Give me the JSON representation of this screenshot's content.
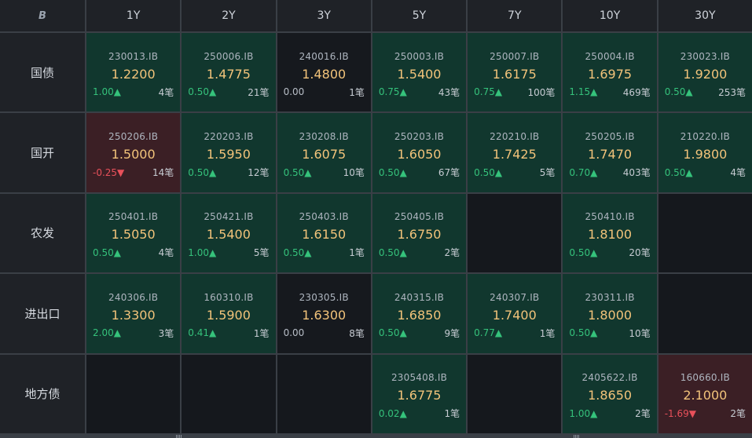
{
  "corner_label": "B",
  "columns": [
    "1Y",
    "2Y",
    "3Y",
    "5Y",
    "7Y",
    "10Y",
    "30Y"
  ],
  "rows": [
    {
      "label": "国债",
      "cells": [
        {
          "code": "230013.IB",
          "price": "1.2200",
          "change": "1.00▲",
          "count": "4笔",
          "dir": "up",
          "bg": "green"
        },
        {
          "code": "250006.IB",
          "price": "1.4775",
          "change": "0.50▲",
          "count": "21笔",
          "dir": "up",
          "bg": "green"
        },
        {
          "code": "240016.IB",
          "price": "1.4800",
          "change": "0.00",
          "count": "1笔",
          "dir": "flat",
          "bg": "dark"
        },
        {
          "code": "250003.IB",
          "price": "1.5400",
          "change": "0.75▲",
          "count": "43笔",
          "dir": "up",
          "bg": "green"
        },
        {
          "code": "250007.IB",
          "price": "1.6175",
          "change": "0.75▲",
          "count": "100笔",
          "dir": "up",
          "bg": "green"
        },
        {
          "code": "250004.IB",
          "price": "1.6975",
          "change": "1.15▲",
          "count": "469笔",
          "dir": "up",
          "bg": "green"
        },
        {
          "code": "230023.IB",
          "price": "1.9200",
          "change": "0.50▲",
          "count": "253笔",
          "dir": "up",
          "bg": "green"
        }
      ]
    },
    {
      "label": "国开",
      "cells": [
        {
          "code": "250206.IB",
          "price": "1.5000",
          "change": "-0.25▼",
          "count": "14笔",
          "dir": "down",
          "bg": "red"
        },
        {
          "code": "220203.IB",
          "price": "1.5950",
          "change": "0.50▲",
          "count": "12笔",
          "dir": "up",
          "bg": "green"
        },
        {
          "code": "230208.IB",
          "price": "1.6075",
          "change": "0.50▲",
          "count": "10笔",
          "dir": "up",
          "bg": "green"
        },
        {
          "code": "250203.IB",
          "price": "1.6050",
          "change": "0.50▲",
          "count": "67笔",
          "dir": "up",
          "bg": "green"
        },
        {
          "code": "220210.IB",
          "price": "1.7425",
          "change": "0.50▲",
          "count": "5笔",
          "dir": "up",
          "bg": "green"
        },
        {
          "code": "250205.IB",
          "price": "1.7470",
          "change": "0.70▲",
          "count": "403笔",
          "dir": "up",
          "bg": "green"
        },
        {
          "code": "210220.IB",
          "price": "1.9800",
          "change": "0.50▲",
          "count": "4笔",
          "dir": "up",
          "bg": "green"
        }
      ]
    },
    {
      "label": "农发",
      "cells": [
        {
          "code": "250401.IB",
          "price": "1.5050",
          "change": "0.50▲",
          "count": "4笔",
          "dir": "up",
          "bg": "green"
        },
        {
          "code": "250421.IB",
          "price": "1.5400",
          "change": "1.00▲",
          "count": "5笔",
          "dir": "up",
          "bg": "green"
        },
        {
          "code": "250403.IB",
          "price": "1.6150",
          "change": "0.50▲",
          "count": "1笔",
          "dir": "up",
          "bg": "green"
        },
        {
          "code": "250405.IB",
          "price": "1.6750",
          "change": "0.50▲",
          "count": "2笔",
          "dir": "up",
          "bg": "green"
        },
        null,
        {
          "code": "250410.IB",
          "price": "1.8100",
          "change": "0.50▲",
          "count": "20笔",
          "dir": "up",
          "bg": "green"
        },
        null
      ]
    },
    {
      "label": "进出口",
      "cells": [
        {
          "code": "240306.IB",
          "price": "1.3300",
          "change": "2.00▲",
          "count": "3笔",
          "dir": "up",
          "bg": "green"
        },
        {
          "code": "160310.IB",
          "price": "1.5900",
          "change": "0.41▲",
          "count": "1笔",
          "dir": "up",
          "bg": "green"
        },
        {
          "code": "230305.IB",
          "price": "1.6300",
          "change": "0.00",
          "count": "8笔",
          "dir": "flat",
          "bg": "dark"
        },
        {
          "code": "240315.IB",
          "price": "1.6850",
          "change": "0.50▲",
          "count": "9笔",
          "dir": "up",
          "bg": "green"
        },
        {
          "code": "240307.IB",
          "price": "1.7400",
          "change": "0.77▲",
          "count": "1笔",
          "dir": "up",
          "bg": "green"
        },
        {
          "code": "230311.IB",
          "price": "1.8000",
          "change": "0.50▲",
          "count": "10笔",
          "dir": "up",
          "bg": "green"
        },
        null
      ]
    },
    {
      "label": "地方债",
      "cells": [
        null,
        null,
        null,
        {
          "code": "2305408.IB",
          "price": "1.6775",
          "change": "0.02▲",
          "count": "1笔",
          "dir": "up",
          "bg": "green"
        },
        null,
        {
          "code": "2405622.IB",
          "price": "1.8650",
          "change": "1.00▲",
          "count": "2笔",
          "dir": "up",
          "bg": "green"
        },
        {
          "code": "160660.IB",
          "price": "2.1000",
          "change": "-1.69▼",
          "count": "2笔",
          "dir": "down",
          "bg": "red"
        }
      ]
    }
  ],
  "colors": {
    "up": "#35c27b",
    "down": "#e8505a",
    "price": "#f2c37a",
    "green_bg": "#11372e",
    "red_bg": "#3b1f25"
  }
}
